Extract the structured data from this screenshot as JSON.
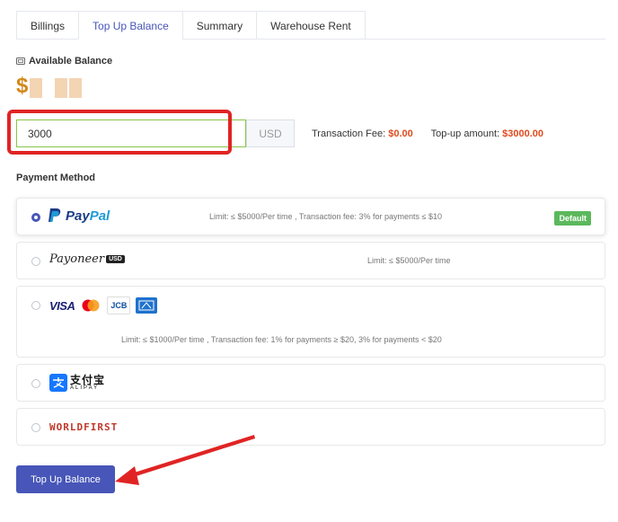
{
  "tabs": [
    {
      "label": "Billings",
      "active": false
    },
    {
      "label": "Top Up Balance",
      "active": true
    },
    {
      "label": "Summary",
      "active": false
    },
    {
      "label": "Warehouse Rent",
      "active": false
    }
  ],
  "balance": {
    "label": "Available Balance",
    "currency_symbol": "$"
  },
  "amount": {
    "value": "3000",
    "unit": "USD"
  },
  "fees": {
    "transaction_fee_label": "Transaction Fee:",
    "transaction_fee_value": "$0.00",
    "topup_amount_label": "Top-up amount:",
    "topup_amount_value": "$3000.00"
  },
  "payment_method_label": "Payment Method",
  "payment_methods": [
    {
      "name": "PayPal",
      "logo_text_1": "Pay",
      "logo_text_2": "Pal",
      "selected": true,
      "limit": "Limit: ≤ $5000/Per time , Transaction fee: 3% for payments ≤ $10",
      "badge": "Default"
    },
    {
      "name": "Payoneer",
      "logo_text": "Payoneer",
      "logo_tag": "USD",
      "selected": false,
      "limit": "Limit: ≤ $5000/Per time"
    },
    {
      "name": "Cards",
      "visa_text": "VISA",
      "jcb_text": "JCB",
      "selected": false,
      "limit": "Limit: ≤ $1000/Per time , Transaction fee: 1% for payments ≥ $20, 3% for payments < $20"
    },
    {
      "name": "Alipay",
      "logo_text_cn": "支付宝",
      "logo_text_en": "ALIPAY",
      "selected": false
    },
    {
      "name": "WorldFirst",
      "logo_text": "WORLDFIRST",
      "selected": false
    }
  ],
  "submit_label": "Top Up Balance",
  "colors": {
    "accent": "#4756b8",
    "highlight_red": "#e02424",
    "fee_orange": "#e04a1c",
    "badge_green": "#5cb85c"
  }
}
